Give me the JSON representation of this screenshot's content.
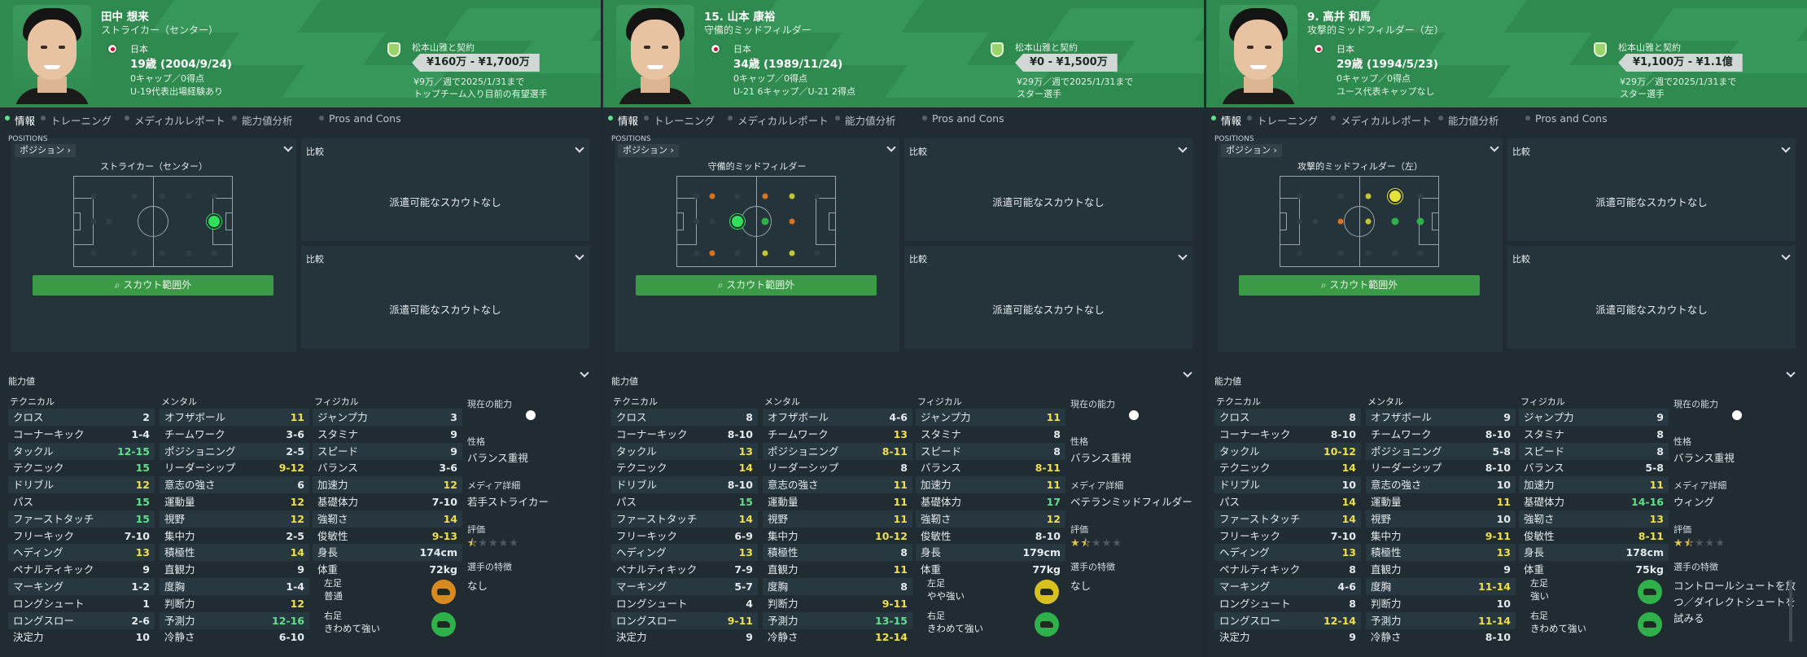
{
  "tabs": [
    "情報",
    "トレーニング",
    "メディカルレポート",
    "能力値分析",
    "Pros and Cons"
  ],
  "common": {
    "positions_title": "POSITIONS",
    "position_select": "ポジション",
    "compare": "比較",
    "no_scouts": "派遣可能なスカウトなし",
    "scout_out": "スカウト範囲外",
    "attributes": "能力値",
    "technical": "テクニカル",
    "mental": "メンタル",
    "physical": "フィジカル",
    "current_ability": "現在の能力",
    "personality": "性格",
    "media": "メディア詳細",
    "rating": "評価",
    "traits": "選手の特徴",
    "height_lbl": "身長",
    "weight_lbl": "体重",
    "left_foot": "左足",
    "right_foot": "右足",
    "nationality": "日本",
    "contract": "松本山雅と契約"
  },
  "players": [
    {
      "name": "田中 想来",
      "position": "ストライカー（センター）",
      "age": "19歳 (2004/9/24)",
      "caps": "0キャップ／0得点",
      "note": "U-19代表出場経験あり",
      "fee": "¥160万 - ¥1,700万",
      "wage": "¥9万／週で2025/1/31まで",
      "status": "トップチーム入り目前の有望選手",
      "field_label": "ストライカー（センター）",
      "technical": [
        [
          "クロス",
          "2"
        ],
        [
          "コーナーキック",
          "1-4"
        ],
        [
          "タックル",
          "12-15"
        ],
        [
          "テクニック",
          "15"
        ],
        [
          "ドリブル",
          "12"
        ],
        [
          "パス",
          "15"
        ],
        [
          "ファーストタッチ",
          "15"
        ],
        [
          "フリーキック",
          "7-10"
        ],
        [
          "ヘディング",
          "13"
        ],
        [
          "ペナルティキック",
          "9"
        ],
        [
          "マーキング",
          "1-2"
        ],
        [
          "ロングシュート",
          "1"
        ],
        [
          "ロングスロー",
          "2-6"
        ],
        [
          "決定力",
          "10"
        ]
      ],
      "mental": [
        [
          "オフザボール",
          "11"
        ],
        [
          "チームワーク",
          "3-6"
        ],
        [
          "ポジショニング",
          "2-5"
        ],
        [
          "リーダーシップ",
          "9-12"
        ],
        [
          "意志の強さ",
          "6"
        ],
        [
          "運動量",
          "12"
        ],
        [
          "視野",
          "12"
        ],
        [
          "集中力",
          "2-5"
        ],
        [
          "積極性",
          "14"
        ],
        [
          "直観力",
          "9"
        ],
        [
          "度胸",
          "1-4"
        ],
        [
          "判断力",
          "12"
        ],
        [
          "予測力",
          "12-16"
        ],
        [
          "冷静さ",
          "6-10"
        ]
      ],
      "physical": [
        [
          "ジャンプ力",
          "3"
        ],
        [
          "スタミナ",
          "9"
        ],
        [
          "スピード",
          "9"
        ],
        [
          "バランス",
          "3-6"
        ],
        [
          "加速力",
          "12"
        ],
        [
          "基礎体力",
          "7-10"
        ],
        [
          "強靭さ",
          "14"
        ],
        [
          "俊敏性",
          "9-13"
        ]
      ],
      "height": "174cm",
      "weight": "72kg",
      "left_foot": "普通",
      "right_foot": "きわめて強い",
      "personality": "バランス重視",
      "media": "若手ストライカー",
      "rating_stars": 0.5,
      "traits": "なし",
      "left_color": "#d98a1e",
      "right_color": "#2eb04a"
    },
    {
      "name": "15. 山本 康裕",
      "position": "守備的ミッドフィルダー",
      "age": "34歳 (1989/11/24)",
      "caps": "0キャップ／0得点",
      "note": "U-21 6キャップ／U-21 2得点",
      "fee": "¥0 - ¥1,500万",
      "wage": "¥29万／週で2025/1/31まで",
      "status": "スター選手",
      "field_label": "守備的ミッドフィルダー",
      "technical": [
        [
          "クロス",
          "8"
        ],
        [
          "コーナーキック",
          "8-10"
        ],
        [
          "タックル",
          "13"
        ],
        [
          "テクニック",
          "14"
        ],
        [
          "ドリブル",
          "8-10"
        ],
        [
          "パス",
          "15"
        ],
        [
          "ファーストタッチ",
          "14"
        ],
        [
          "フリーキック",
          "6-9"
        ],
        [
          "ヘディング",
          "13"
        ],
        [
          "ペナルティキック",
          "7-9"
        ],
        [
          "マーキング",
          "5-7"
        ],
        [
          "ロングシュート",
          "4"
        ],
        [
          "ロングスロー",
          "9-11"
        ],
        [
          "決定力",
          "9"
        ]
      ],
      "mental": [
        [
          "オフザボール",
          "4-6"
        ],
        [
          "チームワーク",
          "13"
        ],
        [
          "ポジショニング",
          "8-11"
        ],
        [
          "リーダーシップ",
          "8"
        ],
        [
          "意志の強さ",
          "11"
        ],
        [
          "運動量",
          "11"
        ],
        [
          "視野",
          "11"
        ],
        [
          "集中力",
          "10-12"
        ],
        [
          "積極性",
          "8"
        ],
        [
          "直観力",
          "11"
        ],
        [
          "度胸",
          "8"
        ],
        [
          "判断力",
          "9-11"
        ],
        [
          "予測力",
          "13-15"
        ],
        [
          "冷静さ",
          "12-14"
        ]
      ],
      "physical": [
        [
          "ジャンプ力",
          "11"
        ],
        [
          "スタミナ",
          "8"
        ],
        [
          "スピード",
          "8"
        ],
        [
          "バランス",
          "8-11"
        ],
        [
          "加速力",
          "11"
        ],
        [
          "基礎体力",
          "17"
        ],
        [
          "強靭さ",
          "12"
        ],
        [
          "俊敏性",
          "8-10"
        ]
      ],
      "height": "179cm",
      "weight": "77kg",
      "left_foot": "やや強い",
      "right_foot": "きわめて強い",
      "personality": "バランス重視",
      "media": "ベテランミッドフィルダー",
      "rating_stars": 1.5,
      "traits": "なし",
      "left_color": "#d8c020",
      "right_color": "#2eb04a"
    },
    {
      "name": "9. 高井 和馬",
      "position": "攻撃的ミッドフィルダー（左）",
      "age": "29歳 (1994/5/23)",
      "caps": "0キャップ／0得点",
      "note": "ユース代表キャップなし",
      "fee": "¥1,100万 - ¥1.1億",
      "wage": "¥29万／週で2025/1/31まで",
      "status": "スター選手",
      "field_label": "攻撃的ミッドフィルダー（左）",
      "technical": [
        [
          "クロス",
          "8"
        ],
        [
          "コーナーキック",
          "8-10"
        ],
        [
          "タックル",
          "10-12"
        ],
        [
          "テクニック",
          "14"
        ],
        [
          "ドリブル",
          "10"
        ],
        [
          "パス",
          "14"
        ],
        [
          "ファーストタッチ",
          "14"
        ],
        [
          "フリーキック",
          "7-10"
        ],
        [
          "ヘディング",
          "13"
        ],
        [
          "ペナルティキック",
          "8"
        ],
        [
          "マーキング",
          "4-6"
        ],
        [
          "ロングシュート",
          "8"
        ],
        [
          "ロングスロー",
          "12-14"
        ],
        [
          "決定力",
          "9"
        ]
      ],
      "mental": [
        [
          "オフザボール",
          "9"
        ],
        [
          "チームワーク",
          "8-10"
        ],
        [
          "ポジショニング",
          "5-8"
        ],
        [
          "リーダーシップ",
          "8-10"
        ],
        [
          "意志の強さ",
          "10"
        ],
        [
          "運動量",
          "11"
        ],
        [
          "視野",
          "10"
        ],
        [
          "集中力",
          "9-11"
        ],
        [
          "積極性",
          "13"
        ],
        [
          "直観力",
          "9"
        ],
        [
          "度胸",
          "11-14"
        ],
        [
          "判断力",
          "10"
        ],
        [
          "予測力",
          "11-14"
        ],
        [
          "冷静さ",
          "8-10"
        ]
      ],
      "physical": [
        [
          "ジャンプ力",
          "9"
        ],
        [
          "スタミナ",
          "8"
        ],
        [
          "スピード",
          "8"
        ],
        [
          "バランス",
          "5-8"
        ],
        [
          "加速力",
          "11"
        ],
        [
          "基礎体力",
          "14-16"
        ],
        [
          "強靭さ",
          "13"
        ],
        [
          "俊敏性",
          "8-11"
        ]
      ],
      "height": "178cm",
      "weight": "75kg",
      "left_foot": "強い",
      "right_foot": "きわめて強い",
      "personality": "バランス重視",
      "media": "ウィング",
      "rating_stars": 1.5,
      "traits": "コントロールシュートを放つ／ダイレクトシュートを試みる",
      "left_color": "#2eb04a",
      "right_color": "#2eb04a"
    }
  ]
}
